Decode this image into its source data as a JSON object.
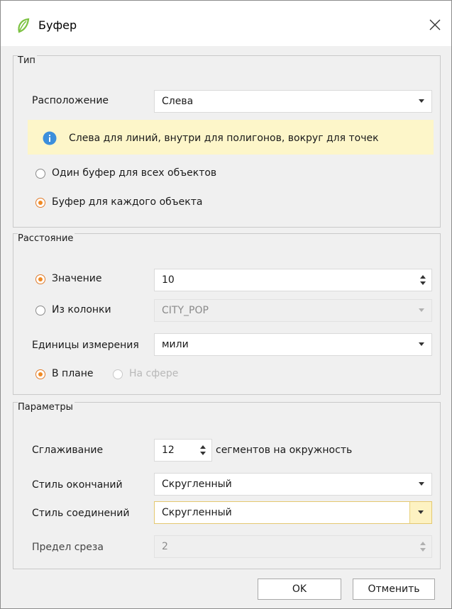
{
  "window": {
    "title": "Буфер",
    "close_icon": "close-icon",
    "app_icon": "leaf-icon"
  },
  "type_group": {
    "label": "Тип",
    "location_label": "Расположение",
    "location_value": "Слева",
    "info_text": "Слева для линий, внутри для полигонов, вокруг для точек",
    "radio_single": "Один буфер для всех объектов",
    "radio_each": "Буфер для каждого объекта",
    "selected": "each"
  },
  "distance_group": {
    "label": "Расстояние",
    "radio_value": "Значение",
    "value": "10",
    "radio_column": "Из колонки",
    "column_value": "CITY_POP",
    "units_label": "Единицы измерения",
    "units_value": "мили",
    "radio_plane": "В плане",
    "radio_sphere": "На сфере"
  },
  "params_group": {
    "label": "Параметры",
    "smoothing_label": "Сглаживание",
    "smoothing_value": "12",
    "smoothing_suffix": "сегментов на окружность",
    "end_style_label": "Стиль окончаний",
    "end_style_value": "Скругленный",
    "join_style_label": "Стиль соединений",
    "join_style_value": "Скругленный",
    "miter_label": "Предел среза",
    "miter_value": "2"
  },
  "buttons": {
    "ok": "OK",
    "cancel": "Отменить"
  },
  "colors": {
    "accent": "#f08a24",
    "info_bg": "#fdf6c9",
    "info_icon": "#3c8fdc",
    "leaf": "#7cc242"
  }
}
